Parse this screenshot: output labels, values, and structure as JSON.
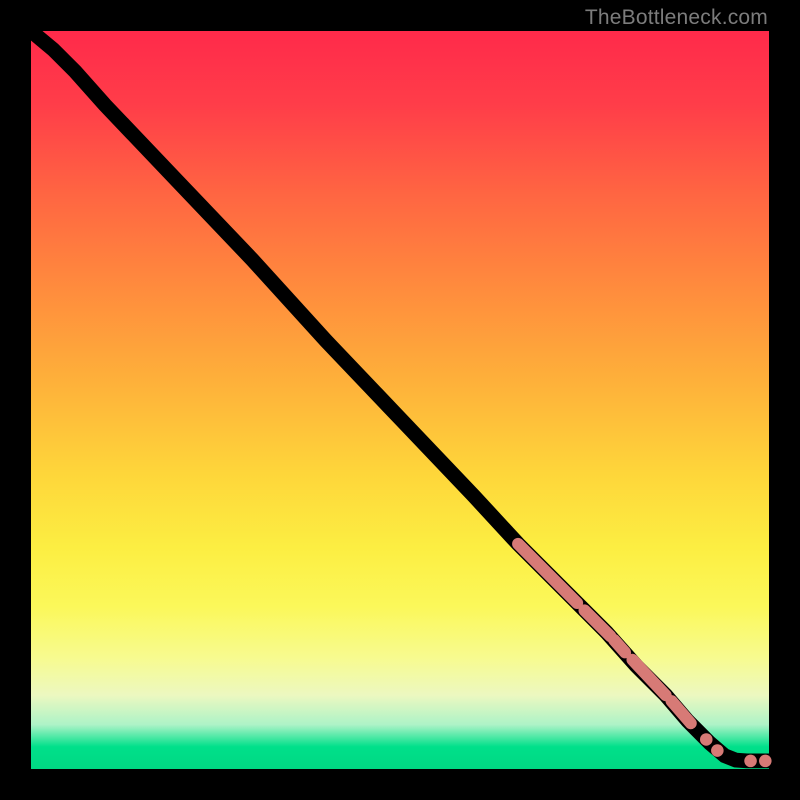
{
  "watermark": "TheBottleneck.com",
  "colors": {
    "dot": "#d77a76",
    "curve": "#000000"
  },
  "chart_data": {
    "type": "line",
    "title": "",
    "xlabel": "",
    "ylabel": "",
    "xlim": [
      0,
      100
    ],
    "ylim": [
      0,
      100
    ],
    "grid": false,
    "legend": false,
    "curve": [
      {
        "x": 0,
        "y": 100
      },
      {
        "x": 3,
        "y": 97.5
      },
      {
        "x": 6,
        "y": 94.5
      },
      {
        "x": 10,
        "y": 90
      },
      {
        "x": 20,
        "y": 79.5
      },
      {
        "x": 30,
        "y": 69
      },
      {
        "x": 40,
        "y": 58
      },
      {
        "x": 50,
        "y": 47.5
      },
      {
        "x": 60,
        "y": 37
      },
      {
        "x": 66,
        "y": 30.5
      },
      {
        "x": 70,
        "y": 26.5
      },
      {
        "x": 74,
        "y": 22.5
      },
      {
        "x": 78,
        "y": 18.5
      },
      {
        "x": 82,
        "y": 14
      },
      {
        "x": 86,
        "y": 10
      },
      {
        "x": 89,
        "y": 6.5
      },
      {
        "x": 92,
        "y": 3.5
      },
      {
        "x": 94,
        "y": 1.8
      },
      {
        "x": 95.5,
        "y": 1.2
      },
      {
        "x": 97,
        "y": 1.1
      },
      {
        "x": 98.5,
        "y": 1.1
      },
      {
        "x": 100,
        "y": 1.1
      }
    ],
    "highlight_segments": [
      {
        "x0": 66,
        "y0": 30.5,
        "x1": 74,
        "y1": 22.5
      },
      {
        "x0": 75,
        "y0": 21.5,
        "x1": 78.5,
        "y1": 18
      },
      {
        "x0": 79,
        "y0": 17.5,
        "x1": 80.5,
        "y1": 15.8
      },
      {
        "x0": 81.5,
        "y0": 14.8,
        "x1": 86,
        "y1": 10
      },
      {
        "x0": 86.8,
        "y0": 9.2,
        "x1": 89.4,
        "y1": 6.2
      }
    ],
    "highlight_points": [
      {
        "x": 91.5,
        "y": 4.0
      },
      {
        "x": 93.0,
        "y": 2.5
      },
      {
        "x": 97.5,
        "y": 1.1
      },
      {
        "x": 99.5,
        "y": 1.1
      }
    ]
  }
}
